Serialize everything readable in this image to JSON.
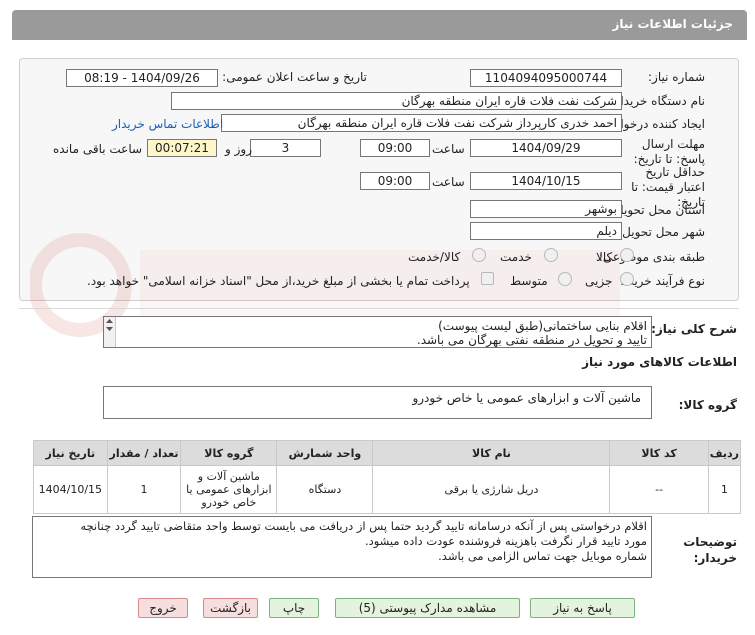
{
  "header": {
    "title": "جزئیات اطلاعات نیاز"
  },
  "form": {
    "need_number_label": "شماره نیاز:",
    "need_number": "1104094095000744",
    "announce_datetime_label": "تاریخ و ساعت اعلان عمومی:",
    "announce_datetime": "1404/09/26 - 08:19",
    "buyer_org_label": "نام دستگاه خریدار:",
    "buyer_org": "شرکت نفت فلات قاره ایران منطقه بهرگان",
    "creator_label": "ایجاد کننده درخواست:",
    "creator": "احمد خدری کارپرداز شرکت نفت فلات قاره ایران منطقه بهرگان",
    "contact_link": "اطلاعات تماس خریدار",
    "reply_deadline_label": "مهلت ارسال پاسخ: تا تاریخ:",
    "reply_date": "1404/09/29",
    "time_label": "ساعت",
    "reply_time": "09:00",
    "days_value": "3",
    "days_label": "روز و",
    "remaining_time": "00:07:21",
    "remaining_label": "ساعت باقی مانده",
    "validity_label": "حداقل تاریخ اعتبار قیمت: تا تاریخ:",
    "validity_date": "1404/10/15",
    "validity_time": "09:00",
    "province_label": "استان محل تحویل:",
    "province": "بوشهر",
    "city_label": "شهر محل تحویل:",
    "city": "دیلم",
    "category_label": "طبقه بندی موضوعی:",
    "category_options": [
      "کالا",
      "خدمت",
      "کالا/خدمت"
    ],
    "process_label": "نوع فرآیند خرید :",
    "process_options": [
      "جزیی",
      "متوسط"
    ],
    "payment_note": "پرداخت تمام یا بخشی از مبلغ خرید،از محل \"اسناد خزانه اسلامی\" خواهد بود."
  },
  "summary": {
    "label": "شرح کلی نیاز:",
    "line1": "اقلام بنایی ساختمانی(طبق لیست پیوست)",
    "line2": "تایید و تحویل در منطقه نفتی بهرگان می باشد."
  },
  "goods": {
    "section_title": "اطلاعات کالاهای مورد نیاز",
    "group_label": "گروه کالا:",
    "group_value": "ماشین آلات و ابزارهای عمومی یا خاص خودرو",
    "columns": [
      "ردیف",
      "کد کالا",
      "نام کالا",
      "واحد شمارش",
      "گروه کالا",
      "تعداد / مقدار",
      "تاریخ نیاز"
    ],
    "rows": [
      {
        "row": "1",
        "code": "--",
        "name": "دریل شارژی یا برقی",
        "unit": "دستگاه",
        "group": "ماشین آلات و ابزارهای عمومی یا خاص خودرو",
        "qty": "1",
        "date": "1404/10/15"
      }
    ]
  },
  "buyer_notes": {
    "label": "توضیحات خریدار:",
    "line1": "اقلام درخواستی پس از آنکه درسامانه تایید گردید حتما پس از دریافت می بایست توسط واحد متقاضی تایید گردد چنانچه",
    "line2": "مورد تایید قرار نگرفت باهزینه فروشنده عودت داده میشود.",
    "line3": "شماره موبایل جهت تماس الزامی می باشد."
  },
  "buttons": {
    "reply": "پاسخ به نیاز",
    "view_docs": "مشاهده مدارک پیوستی (5)",
    "print": "چاپ",
    "back": "بازگشت",
    "exit": "خروج"
  },
  "colors": {
    "title_bar": "#9a9a9a",
    "link": "#1a5fb4",
    "highlight": "#fdf6c8",
    "button_green": "#e4f3de",
    "button_red": "#f6dede"
  }
}
